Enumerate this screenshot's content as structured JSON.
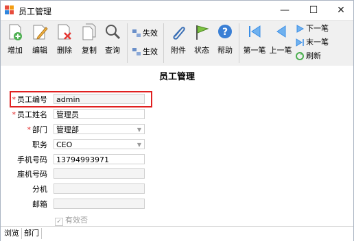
{
  "window": {
    "title": "员工管理",
    "controls": {
      "minimize": "—",
      "maximize": "☐",
      "close": "✕"
    }
  },
  "toolbar": {
    "add": "增加",
    "edit": "编辑",
    "delete": "删除",
    "copy": "复制",
    "query": "查询",
    "invalidate": "失效",
    "validate": "生效",
    "attachment": "附件",
    "status": "状态",
    "help": "帮助",
    "first": "第一笔",
    "prev": "上一笔",
    "next": "下一笔",
    "last": "末一笔",
    "refresh": "刷新"
  },
  "form": {
    "title": "员工管理",
    "fields": [
      {
        "label": "员工编号",
        "required": true,
        "value": "admin"
      },
      {
        "label": "员工姓名",
        "required": true,
        "value": "管理员"
      },
      {
        "label": "部门",
        "required": true,
        "value": "管理部"
      },
      {
        "label": "职务",
        "required": false,
        "value": "CEO"
      },
      {
        "label": "手机号码",
        "required": false,
        "value": "13794993971"
      },
      {
        "label": "座机号码",
        "required": false,
        "value": ""
      },
      {
        "label": "分机",
        "required": false,
        "value": ""
      },
      {
        "label": "邮箱",
        "required": false,
        "value": ""
      }
    ],
    "active_label": "有效否",
    "active_checked": true,
    "required_marker": "*",
    "dropdown_arrow": "▼"
  },
  "tabs": [
    "浏览",
    "部门"
  ],
  "colors": {
    "highlight": "#e02020",
    "required": "#e02020",
    "nav_blue": "#3a8ee6"
  }
}
